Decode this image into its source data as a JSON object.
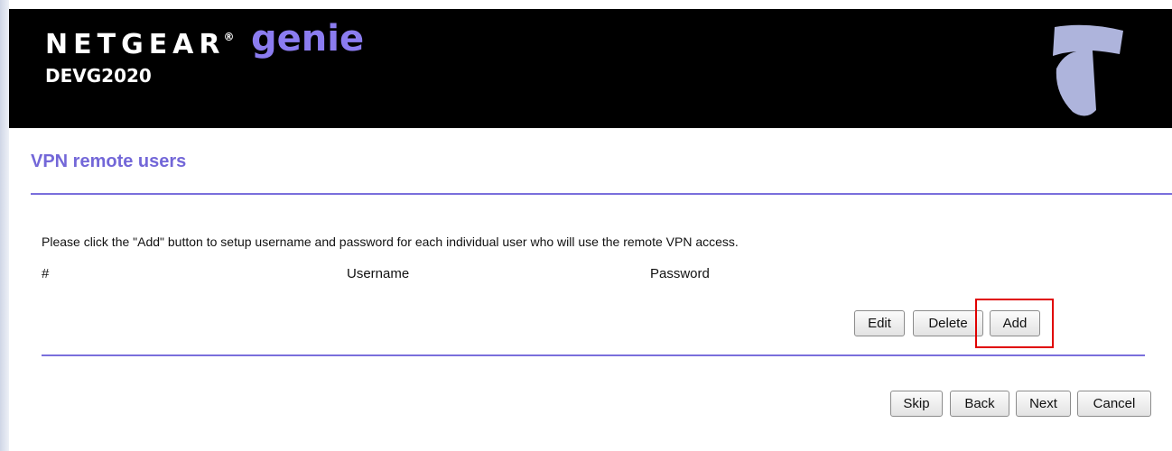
{
  "header": {
    "brand": "NETGEAR",
    "brand_mark": "®",
    "product": "genie",
    "model": "DEVG2020"
  },
  "page": {
    "title": "VPN remote users",
    "instructions": "Please click the \"Add\" button to setup username and password for each individual user who will use the remote VPN access."
  },
  "table": {
    "columns": [
      "#",
      "Username",
      "Password"
    ]
  },
  "user_actions": {
    "edit": "Edit",
    "delete": "Delete",
    "add": "Add"
  },
  "wizard_nav": {
    "skip": "Skip",
    "back": "Back",
    "next": "Next",
    "cancel": "Cancel"
  },
  "colors": {
    "header_bg": "#000000",
    "accent": "#7367d8",
    "genie": "#8b7cf0",
    "highlight": "#e00000",
    "logo": "#aeb4dc"
  },
  "icons": {
    "carrier_logo": "telstra-t-logo"
  }
}
